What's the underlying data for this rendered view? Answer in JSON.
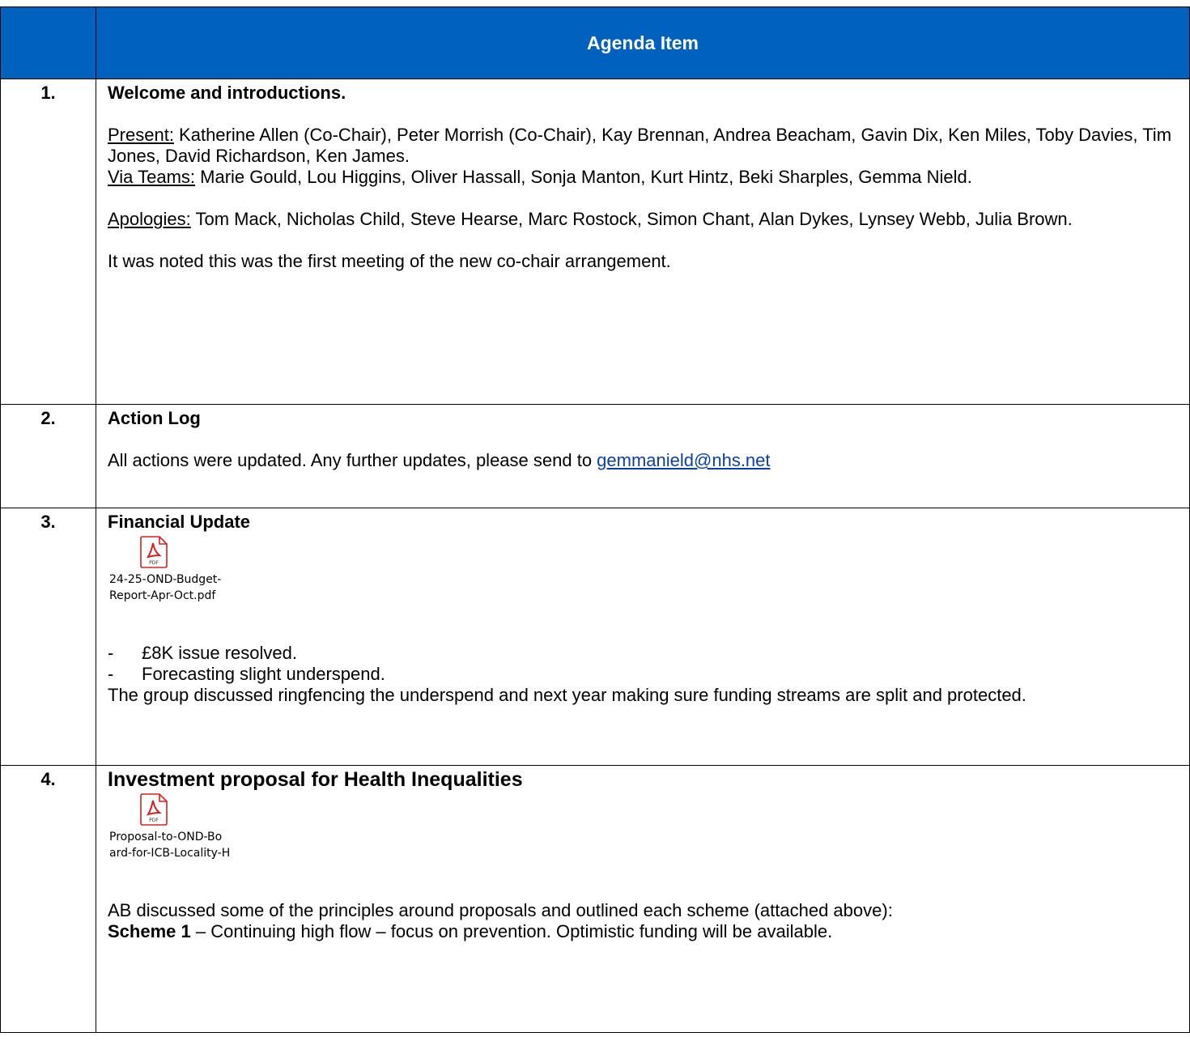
{
  "header": {
    "col1": "",
    "col2": "Agenda Item"
  },
  "item1": {
    "number": "1.",
    "title": "Welcome and introductions.",
    "present_label": "Present:",
    "present_text": " Katherine Allen (Co-Chair), Peter Morrish (Co-Chair), Kay Brennan, Andrea Beacham, Gavin Dix, Ken Miles, Toby Davies, Tim Jones, David Richardson, Ken James.",
    "teams_label": "Via Teams:",
    "teams_text": " Marie Gould, Lou Higgins, Oliver Hassall, Sonja Manton, Kurt Hintz, Beki Sharples, Gemma Nield.",
    "apologies_label": "Apologies:",
    "apologies_text": " Tom Mack, Nicholas Child, Steve Hearse, Marc Rostock, Simon Chant, Alan Dykes, Lynsey Webb, Julia Brown.",
    "note": "It was noted this was the first meeting of the new co-chair arrangement."
  },
  "item2": {
    "number": "2.",
    "title": "Action Log",
    "text": "All actions were updated.  Any further updates, please send to ",
    "email": "gemmanield@nhs.net"
  },
  "item3": {
    "number": "3.",
    "title": "Financial Update",
    "attachment_line1": "24-25-OND-Budget-",
    "attachment_line2": "Report-Apr-Oct.pdf",
    "bullets": [
      "£8K issue resolved.",
      "Forecasting slight underspend."
    ],
    "bullet_marker": "-",
    "text": "The group discussed ringfencing the underspend and next year making sure funding streams are split and protected."
  },
  "item4": {
    "number": "4.",
    "title": "Investment proposal for Health Inequalities",
    "attachment_line1": "Proposal-to-OND-Bo",
    "attachment_line2": "ard-for-ICB-Locality-H",
    "text": "AB discussed some of the principles around proposals and outlined each scheme (attached above):",
    "scheme_label": "Scheme 1",
    "scheme_text": " – Continuing high flow – focus on prevention.  Optimistic funding will be available."
  },
  "icons": {
    "attachment": "pdf-icon"
  },
  "colors": {
    "header_bg": "#0061bf",
    "link": "#0b3fa8",
    "pdf_red": "#d9201f"
  }
}
